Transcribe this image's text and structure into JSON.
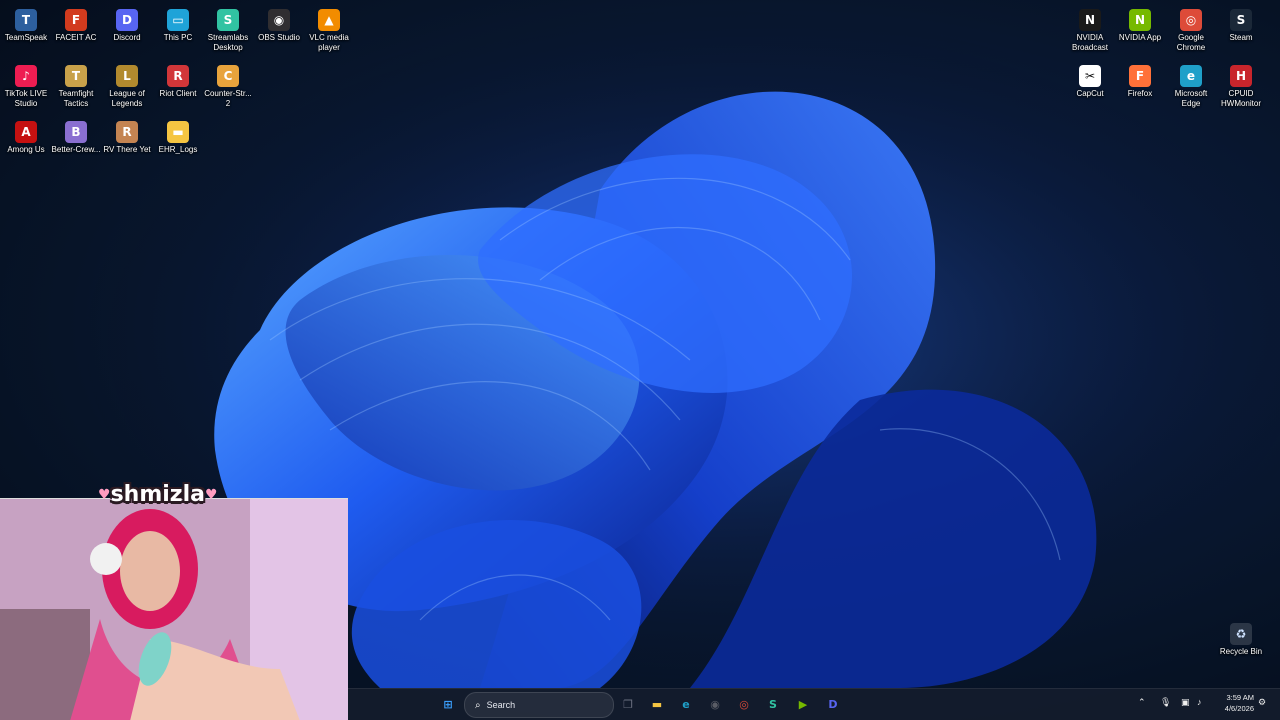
{
  "desktop": {
    "left_icons": [
      {
        "label": "TeamSpeak",
        "icon": "teamspeak-icon",
        "color": "#2d5f9e",
        "glyph": "T"
      },
      {
        "label": "FACEIT AC",
        "icon": "faceit-icon",
        "color": "#d23b1e",
        "glyph": "F"
      },
      {
        "label": "Discord",
        "icon": "discord-icon",
        "color": "#5865f2",
        "glyph": "D"
      },
      {
        "label": "This PC",
        "icon": "computer-icon",
        "color": "#1fa3d8",
        "glyph": "▭"
      },
      {
        "label": "Streamlabs Desktop",
        "icon": "streamlabs-icon",
        "color": "#31c3a2",
        "glyph": "S"
      },
      {
        "label": "OBS Studio",
        "icon": "obs-icon",
        "color": "#302e31",
        "glyph": "◉"
      },
      {
        "label": "VLC media player",
        "icon": "vlc-icon",
        "color": "#f28c00",
        "glyph": "▲"
      },
      {
        "label": "TikTok LIVE Studio",
        "icon": "tiktok-icon",
        "color": "#ee1d52",
        "glyph": "♪"
      },
      {
        "label": "Teamfight Tactics",
        "icon": "tft-icon",
        "color": "#c8a14a",
        "glyph": "T"
      },
      {
        "label": "League of Legends",
        "icon": "lol-icon",
        "color": "#b28a2e",
        "glyph": "L"
      },
      {
        "label": "Riot Client",
        "icon": "riot-icon",
        "color": "#d13639",
        "glyph": "R"
      },
      {
        "label": "Counter-Str... 2",
        "icon": "cs2-icon",
        "color": "#e8a33c",
        "glyph": "C"
      },
      {
        "label": "Among Us",
        "icon": "amongus-icon",
        "color": "#c51111",
        "glyph": "A"
      },
      {
        "label": "Better-Crew...",
        "icon": "bettercrewlink-icon",
        "color": "#8a6fd1",
        "glyph": "B"
      },
      {
        "label": "RV There Yet",
        "icon": "rvthereyet-icon",
        "color": "#c48452",
        "glyph": "R"
      },
      {
        "label": "EHR_Logs",
        "icon": "folder-icon",
        "color": "#f5c542",
        "glyph": "▬"
      }
    ],
    "right_icons": [
      {
        "label": "NVIDIA Broadcast",
        "icon": "nvidia-broadcast-icon",
        "color": "#1a1a1a",
        "glyph": "N"
      },
      {
        "label": "NVIDIA App",
        "icon": "nvidia-app-icon",
        "color": "#76b900",
        "glyph": "N"
      },
      {
        "label": "Google Chrome",
        "icon": "chrome-icon",
        "color": "#dd4b39",
        "glyph": "◎"
      },
      {
        "label": "Steam",
        "icon": "steam-icon",
        "color": "#1b2838",
        "glyph": "S"
      },
      {
        "label": "CapCut",
        "icon": "capcut-icon",
        "color": "#ffffff",
        "glyph": "✂"
      },
      {
        "label": "Firefox",
        "icon": "firefox-icon",
        "color": "#ff7139",
        "glyph": "F"
      },
      {
        "label": "Microsoft Edge",
        "icon": "edge-icon",
        "color": "#1fa0c9",
        "glyph": "e"
      },
      {
        "label": "CPUID HWMonitor",
        "icon": "hwmonitor-icon",
        "color": "#c8252c",
        "glyph": "H"
      }
    ],
    "recycle_bin": {
      "label": "Recycle Bin",
      "icon": "recycle-bin-icon"
    }
  },
  "webcam": {
    "name": "shmizla"
  },
  "taskbar": {
    "search_label": "Search",
    "pinned": [
      {
        "name": "start-button",
        "icon": "windows-start-icon",
        "color": "#3aa0ff",
        "glyph": "⊞"
      },
      {
        "name": "task-view-button",
        "icon": "task-view-icon",
        "color": "#6b7080",
        "glyph": "❐"
      },
      {
        "name": "file-explorer-button",
        "icon": "folder-icon",
        "color": "#f5c542",
        "glyph": "▬"
      },
      {
        "name": "edge-button",
        "icon": "edge-icon",
        "color": "#1fa0c9",
        "glyph": "e"
      },
      {
        "name": "obs-button",
        "icon": "obs-icon",
        "color": "#5a5d66",
        "glyph": "◉"
      },
      {
        "name": "chrome-button",
        "icon": "chrome-icon",
        "color": "#dd4b39",
        "glyph": "◎"
      },
      {
        "name": "streamlabs-button",
        "icon": "streamlabs-icon",
        "color": "#31c3a2",
        "glyph": "S"
      },
      {
        "name": "nvidia-button",
        "icon": "nvidia-app-icon",
        "color": "#76b900",
        "glyph": "▶"
      },
      {
        "name": "discord-button",
        "icon": "discord-icon",
        "color": "#5865f2",
        "glyph": "D"
      }
    ],
    "tray": {
      "time": "3:59 AM",
      "date": "4/6/2026"
    }
  }
}
